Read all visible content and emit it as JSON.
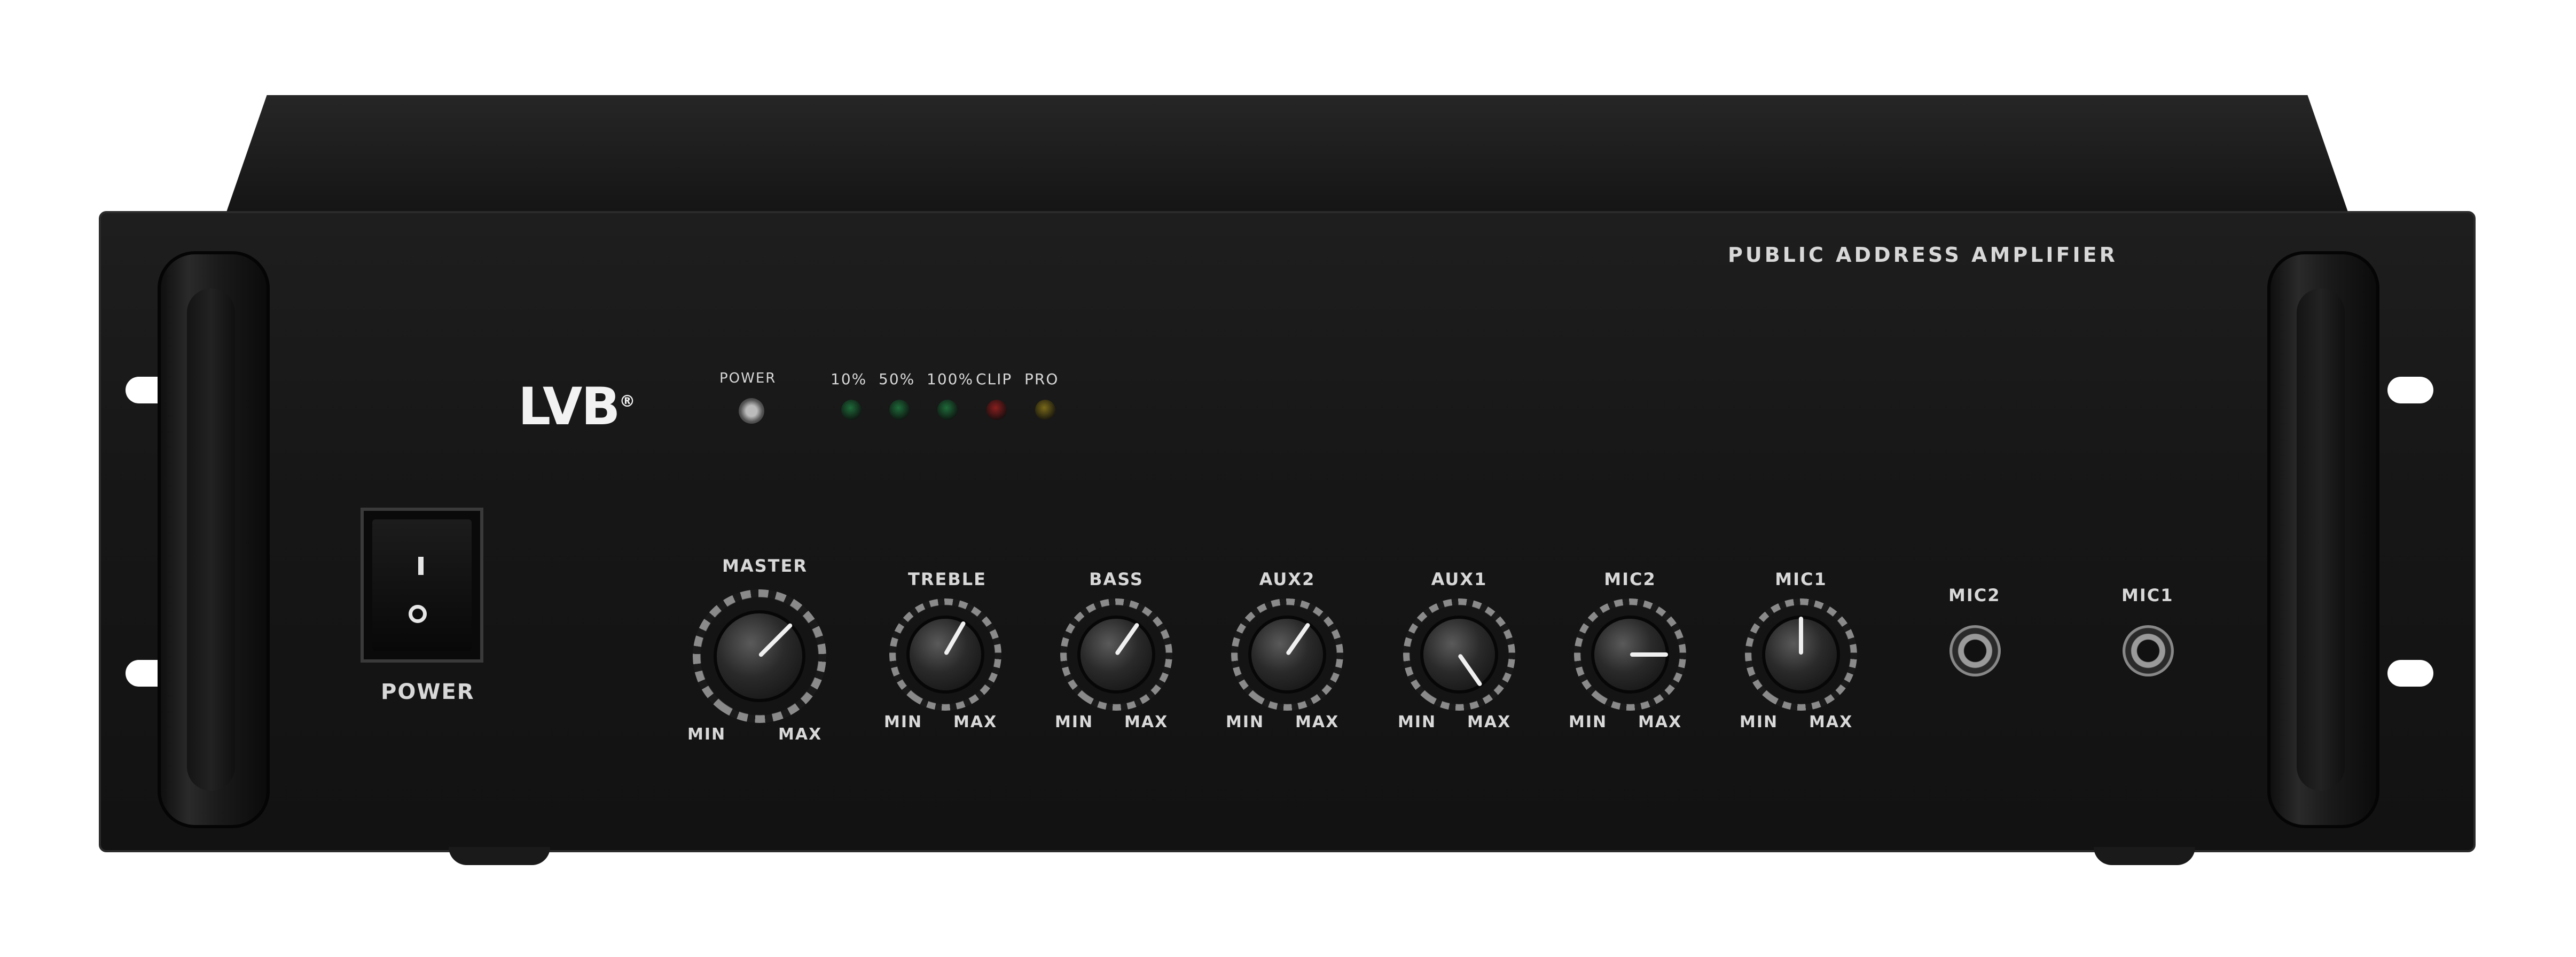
{
  "panel": {
    "model_title": "PUBLIC ADDRESS AMPLIFIER",
    "brand": "LVB",
    "brand_mark": "®"
  },
  "power_switch": {
    "label": "POWER",
    "on_symbol": "I",
    "off_symbol": "O"
  },
  "indicators": {
    "power_label": "POWER",
    "leds": [
      {
        "label": "10%",
        "color": "#1f6b3a"
      },
      {
        "label": "50%",
        "color": "#1f6b3a"
      },
      {
        "label": "100%",
        "color": "#1f6b3a"
      },
      {
        "label": "CLIP",
        "color": "#8a1f1f"
      },
      {
        "label": "PRO",
        "color": "#7a6a1a"
      }
    ]
  },
  "knobs": [
    {
      "label": "MASTER",
      "min_label": "MIN",
      "max_label": "MAX"
    },
    {
      "label": "TREBLE",
      "min_label": "MIN",
      "max_label": "MAX"
    },
    {
      "label": "BASS",
      "min_label": "MIN",
      "max_label": "MAX"
    },
    {
      "label": "AUX2",
      "min_label": "MIN",
      "max_label": "MAX"
    },
    {
      "label": "AUX1",
      "min_label": "MIN",
      "max_label": "MAX"
    },
    {
      "label": "MIC2",
      "min_label": "MIN",
      "max_label": "MAX"
    },
    {
      "label": "MIC1",
      "min_label": "MIN",
      "max_label": "MAX"
    }
  ],
  "jacks": [
    {
      "label": "MIC2"
    },
    {
      "label": "MIC1"
    }
  ]
}
